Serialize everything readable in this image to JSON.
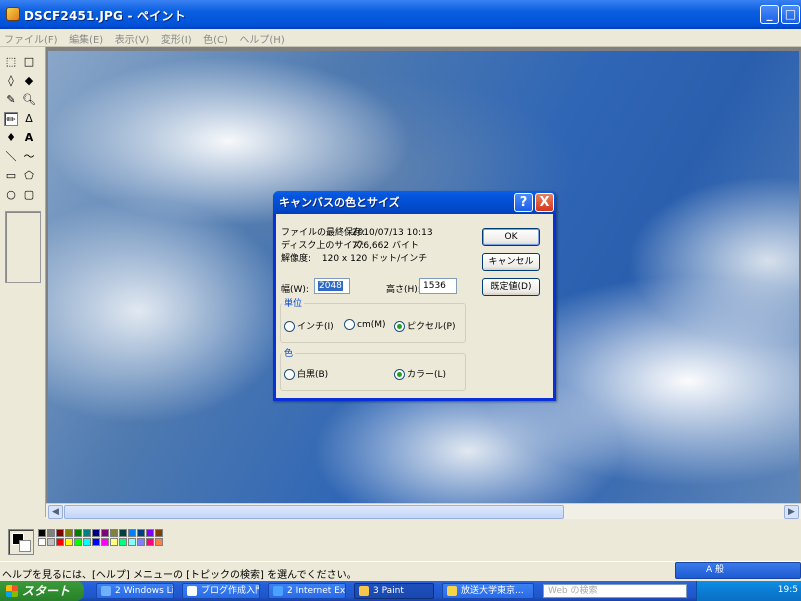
{
  "window": {
    "title": "DSCF2451.JPG - ペイント",
    "minimize_label": "_",
    "maximize_label": "□"
  },
  "menu": {
    "items": [
      "ファイル(F)",
      "編集(E)",
      "表示(V)",
      "変形(I)",
      "色(C)",
      "ヘルプ(H)"
    ]
  },
  "toolbox": {
    "tools": [
      {
        "name": "free-select",
        "glyph": "⬚"
      },
      {
        "name": "rect-select",
        "glyph": "□"
      },
      {
        "name": "eraser",
        "glyph": "◊"
      },
      {
        "name": "fill",
        "glyph": "◆"
      },
      {
        "name": "picker",
        "glyph": "✎"
      },
      {
        "name": "magnifier",
        "glyph": "🔍︎"
      },
      {
        "name": "pencil",
        "glyph": "✏"
      },
      {
        "name": "brush",
        "glyph": "ᐃ"
      },
      {
        "name": "airbrush",
        "glyph": "♦"
      },
      {
        "name": "text",
        "glyph": "A"
      },
      {
        "name": "line",
        "glyph": "＼"
      },
      {
        "name": "curve",
        "glyph": "～"
      },
      {
        "name": "rectangle",
        "glyph": "▭"
      },
      {
        "name": "polygon",
        "glyph": "⬠"
      },
      {
        "name": "ellipse",
        "glyph": "○"
      },
      {
        "name": "rounded-rect",
        "glyph": "▢"
      }
    ]
  },
  "palette": {
    "colors": [
      "#000000",
      "#808080",
      "#800000",
      "#808000",
      "#008000",
      "#008080",
      "#000080",
      "#800080",
      "#808040",
      "#004040",
      "#0080ff",
      "#004080",
      "#8000ff",
      "#804000",
      "#ffffff",
      "#c0c0c0",
      "#ff0000",
      "#ffff00",
      "#00ff00",
      "#00ffff",
      "#0000ff",
      "#ff00ff",
      "#ffff80",
      "#00ff80",
      "#80ffff",
      "#8080ff",
      "#ff0080",
      "#ff8040"
    ]
  },
  "status": {
    "message": "ヘルプを見るには、[ヘルプ] メニューの [トピックの検索] を選んでください。"
  },
  "dialog": {
    "title": "キャンバスの色とサイズ",
    "help_label": "?",
    "close_label": "X",
    "info": [
      {
        "label": "ファイルの最終保存:",
        "value": "2010/07/13 10:13"
      },
      {
        "label": "ディスク上のサイズ:",
        "value": "776,662 バイト"
      },
      {
        "label": "解像度:",
        "value": "120 x 120 ドット/インチ"
      }
    ],
    "ok_label": "OK",
    "cancel_label": "キャンセル",
    "default_label": "既定値(D)",
    "width_label": "幅(W):",
    "width_value": "2048",
    "height_label": "高さ(H):",
    "height_value": "1536",
    "units_group": "単位",
    "unit_inch": "インチ(I)",
    "unit_cm": "cm(M)",
    "unit_pixel": "ピクセル(P)",
    "color_group": "色",
    "color_bw": "白黒(B)",
    "color_color": "カラー(L)"
  },
  "taskbar": {
    "start_label": "スタート",
    "tasks": [
      {
        "label": "2 Windows Li...",
        "color": "#6fb0ff"
      },
      {
        "label": "ブログ作成入門...",
        "color": "#ffffff"
      },
      {
        "label": "2 Internet Ex...",
        "color": "#4aa3ff"
      },
      {
        "label": "3 Paint",
        "color": "#f7c64a"
      },
      {
        "label": "放送大学東京...",
        "color": "#f7d34a"
      }
    ],
    "search_placeholder": "Web の検索",
    "clock": "19:5"
  },
  "langbar": {
    "label": "A 般"
  }
}
